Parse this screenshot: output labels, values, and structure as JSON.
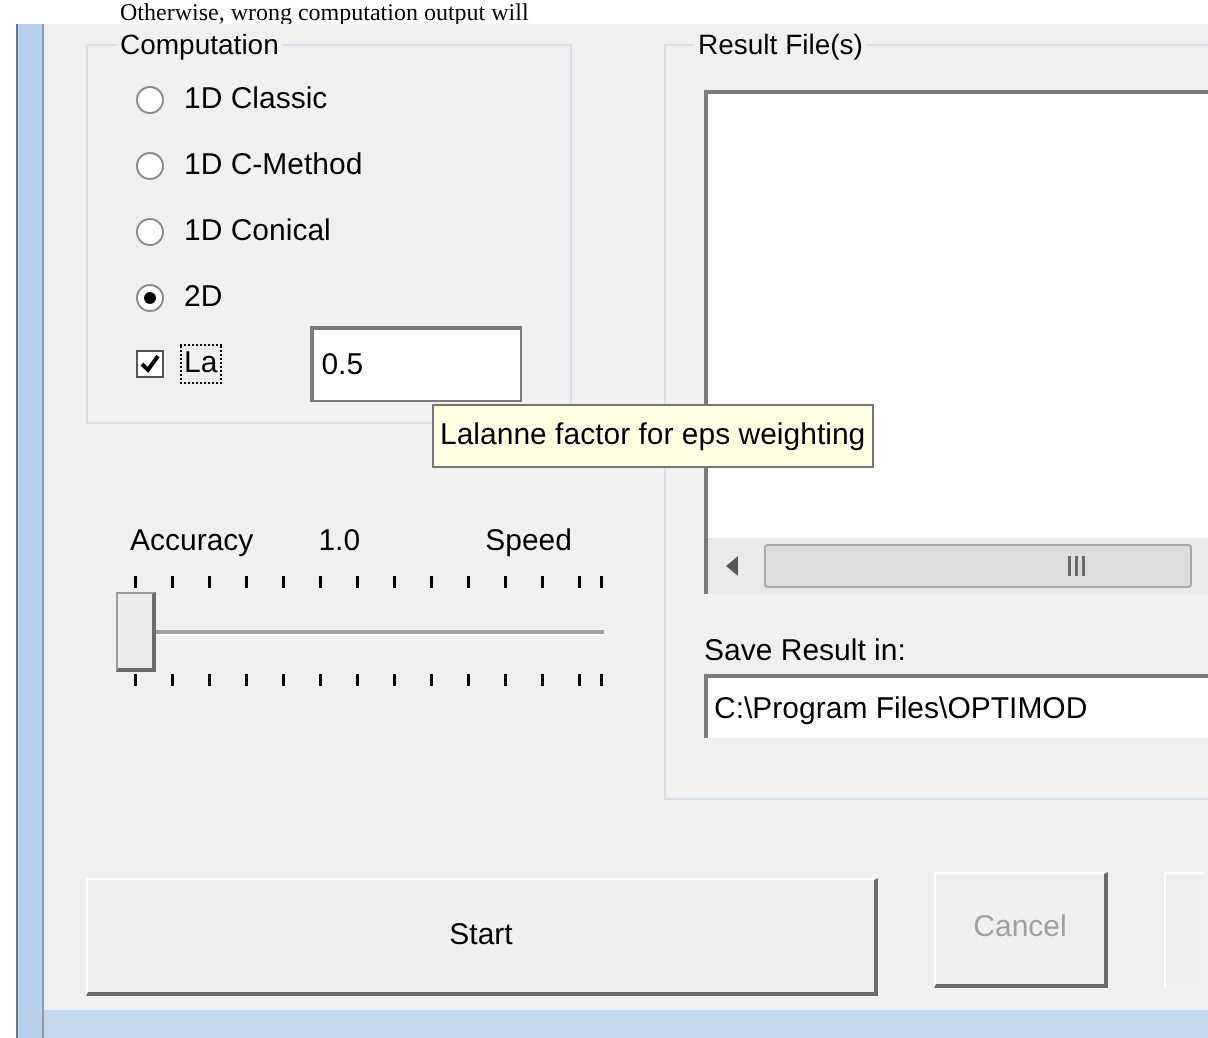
{
  "background_text": "Otherwise, wrong computation output will",
  "computation": {
    "title": "Computation",
    "options": [
      {
        "label": "1D Classic",
        "selected": false
      },
      {
        "label": "1D C-Method",
        "selected": false
      },
      {
        "label": "1D Conical",
        "selected": false
      },
      {
        "label": "2D",
        "selected": true
      }
    ],
    "lalanne": {
      "label": "La",
      "checked": true,
      "value": "0.5"
    }
  },
  "tooltip": "Lalanne factor for eps weighting",
  "slider": {
    "left_label": "Accuracy",
    "value_label": "1.0",
    "right_label": "Speed",
    "level": 0
  },
  "results": {
    "title": "Result File(s)",
    "save_label": "Save Result in:",
    "save_path": "C:\\Program Files\\OPTIMOD"
  },
  "buttons": [
    {
      "label": "Start",
      "disabled": false
    },
    {
      "label": "Cancel",
      "disabled": true
    }
  ]
}
